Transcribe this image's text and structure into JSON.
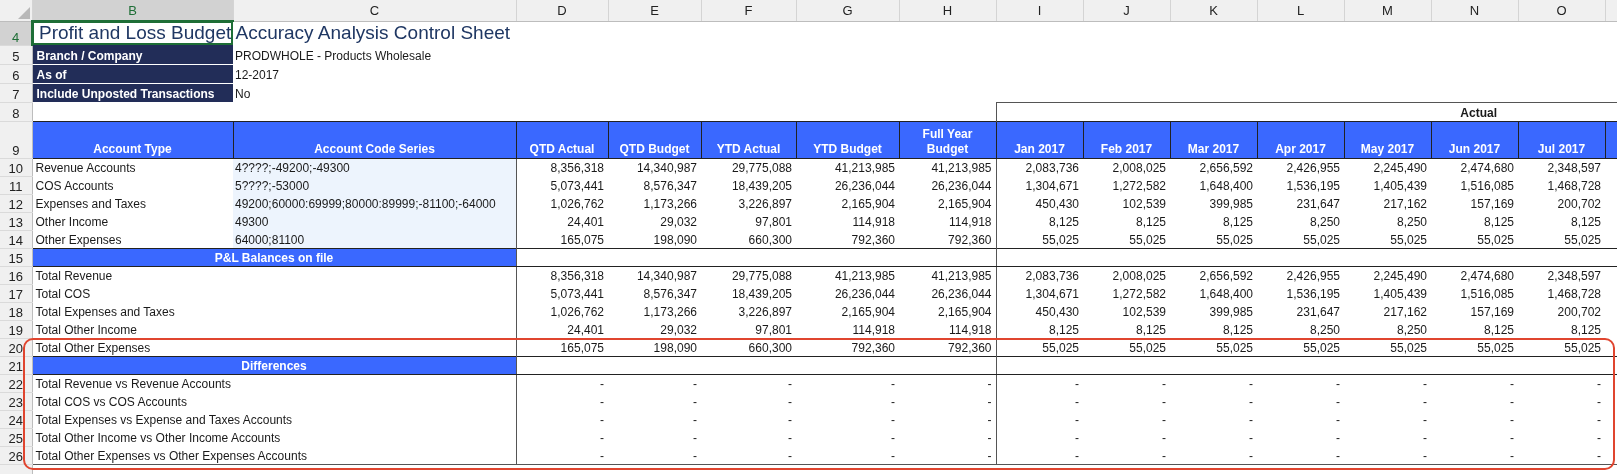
{
  "columns": [
    {
      "letter": "B",
      "selected": true
    },
    {
      "letter": "C",
      "selected": false
    },
    {
      "letter": "D",
      "selected": false
    },
    {
      "letter": "E",
      "selected": false
    },
    {
      "letter": "F",
      "selected": false
    },
    {
      "letter": "G",
      "selected": false
    },
    {
      "letter": "H",
      "selected": false
    },
    {
      "letter": "I",
      "selected": false
    },
    {
      "letter": "J",
      "selected": false
    },
    {
      "letter": "K",
      "selected": false
    },
    {
      "letter": "L",
      "selected": false
    },
    {
      "letter": "M",
      "selected": false
    },
    {
      "letter": "N",
      "selected": false
    },
    {
      "letter": "O",
      "selected": false
    }
  ],
  "rows": [
    {
      "kind": "title",
      "number": "4",
      "selected": true,
      "text": "Profit and Loss Budget Accuracy Analysis Control Sheet"
    },
    {
      "kind": "info",
      "number": "5",
      "selected": false,
      "label": "Branch / Company",
      "value": "PRODWHOLE - Products Wholesale"
    },
    {
      "kind": "info",
      "number": "6",
      "selected": false,
      "label": "As of",
      "value": "12-2017"
    },
    {
      "kind": "info",
      "number": "7",
      "selected": false,
      "label": "Include Unposted Transactions",
      "value": "No"
    },
    {
      "kind": "group",
      "number": "8",
      "selected": false,
      "group_label": "Actual"
    },
    {
      "kind": "header",
      "number": "9",
      "selected": false,
      "cells": [
        "Account Type",
        "Account Code Series",
        "QTD Actual",
        "QTD Budget",
        "YTD Actual",
        "YTD Budget",
        "Full Year Budget",
        "Jan 2017",
        "Feb 2017",
        "Mar 2017",
        "Apr 2017",
        "May 2017",
        "Jun 2017",
        "Jul 2017"
      ]
    },
    {
      "kind": "account",
      "number": "10",
      "selected": false,
      "label": "Revenue Accounts",
      "code": "4????;-49200;-49300",
      "values": [
        "8,356,318",
        "14,340,987",
        "29,775,088",
        "41,213,985",
        "41,213,985",
        "2,083,736",
        "2,008,025",
        "2,656,592",
        "2,426,955",
        "2,245,490",
        "2,474,680",
        "2,348,597"
      ]
    },
    {
      "kind": "account",
      "number": "11",
      "selected": false,
      "label": "COS Accounts",
      "code": "5????;-53000",
      "values": [
        "5,073,441",
        "8,576,347",
        "18,439,205",
        "26,236,044",
        "26,236,044",
        "1,304,671",
        "1,272,582",
        "1,648,400",
        "1,536,195",
        "1,405,439",
        "1,516,085",
        "1,468,728"
      ]
    },
    {
      "kind": "account",
      "number": "12",
      "selected": false,
      "label": "Expenses and Taxes",
      "code": "49200;60000:69999;80000:89999;-81100;-64000",
      "values": [
        "1,026,762",
        "1,173,266",
        "3,226,897",
        "2,165,904",
        "2,165,904",
        "450,430",
        "102,539",
        "399,985",
        "231,647",
        "217,162",
        "157,169",
        "200,702"
      ]
    },
    {
      "kind": "account",
      "number": "13",
      "selected": false,
      "label": "Other Income",
      "code": "49300",
      "values": [
        "24,401",
        "29,032",
        "97,801",
        "114,918",
        "114,918",
        "8,125",
        "8,125",
        "8,125",
        "8,250",
        "8,250",
        "8,125",
        "8,125"
      ]
    },
    {
      "kind": "account",
      "number": "14",
      "selected": false,
      "label": "Other Expenses",
      "code": "64000;81100",
      "values": [
        "165,075",
        "198,090",
        "660,300",
        "792,360",
        "792,360",
        "55,025",
        "55,025",
        "55,025",
        "55,025",
        "55,025",
        "55,025",
        "55,025"
      ]
    },
    {
      "kind": "banner",
      "number": "15",
      "selected": false,
      "heading": "P&L Balances on file"
    },
    {
      "kind": "total",
      "number": "16",
      "selected": false,
      "label": "Total Revenue",
      "values": [
        "8,356,318",
        "14,340,987",
        "29,775,088",
        "41,213,985",
        "41,213,985",
        "2,083,736",
        "2,008,025",
        "2,656,592",
        "2,426,955",
        "2,245,490",
        "2,474,680",
        "2,348,597"
      ]
    },
    {
      "kind": "total",
      "number": "17",
      "selected": false,
      "label": "Total COS",
      "values": [
        "5,073,441",
        "8,576,347",
        "18,439,205",
        "26,236,044",
        "26,236,044",
        "1,304,671",
        "1,272,582",
        "1,648,400",
        "1,536,195",
        "1,405,439",
        "1,516,085",
        "1,468,728"
      ]
    },
    {
      "kind": "total",
      "number": "18",
      "selected": false,
      "label": "Total Expenses and Taxes",
      "values": [
        "1,026,762",
        "1,173,266",
        "3,226,897",
        "2,165,904",
        "2,165,904",
        "450,430",
        "102,539",
        "399,985",
        "231,647",
        "217,162",
        "157,169",
        "200,702"
      ]
    },
    {
      "kind": "total",
      "number": "19",
      "selected": false,
      "label": "Total Other Income",
      "values": [
        "24,401",
        "29,032",
        "97,801",
        "114,918",
        "114,918",
        "8,125",
        "8,125",
        "8,125",
        "8,250",
        "8,250",
        "8,125",
        "8,125"
      ]
    },
    {
      "kind": "total",
      "number": "20",
      "selected": false,
      "label": "Total Other Expenses",
      "values": [
        "165,075",
        "198,090",
        "660,300",
        "792,360",
        "792,360",
        "55,025",
        "55,025",
        "55,025",
        "55,025",
        "55,025",
        "55,025",
        "55,025"
      ]
    },
    {
      "kind": "banner",
      "number": "21",
      "selected": false,
      "heading": "Differences"
    },
    {
      "kind": "difference",
      "number": "22",
      "selected": false,
      "label": "Total Revenue vs Revenue Accounts",
      "values": [
        "-",
        "-",
        "-",
        "-",
        "-",
        "-",
        "-",
        "-",
        "-",
        "-",
        "-",
        "-"
      ]
    },
    {
      "kind": "difference",
      "number": "23",
      "selected": false,
      "label": "Total COS vs COS Accounts",
      "values": [
        "-",
        "-",
        "-",
        "-",
        "-",
        "-",
        "-",
        "-",
        "-",
        "-",
        "-",
        "-"
      ]
    },
    {
      "kind": "difference",
      "number": "24",
      "selected": false,
      "label": "Total Expenses vs Expense and Taxes Accounts",
      "values": [
        "-",
        "-",
        "-",
        "-",
        "-",
        "-",
        "-",
        "-",
        "-",
        "-",
        "-",
        "-"
      ]
    },
    {
      "kind": "difference",
      "number": "25",
      "selected": false,
      "label": "Total Other Income vs Other Income Accounts",
      "values": [
        "-",
        "-",
        "-",
        "-",
        "-",
        "-",
        "-",
        "-",
        "-",
        "-",
        "-",
        "-"
      ]
    },
    {
      "kind": "difference",
      "number": "26",
      "selected": false,
      "label": "Total Other Expenses vs Other Expenses Accounts",
      "values": [
        "-",
        "-",
        "-",
        "-",
        "-",
        "-",
        "-",
        "-",
        "-",
        "-",
        "-",
        "-"
      ]
    }
  ],
  "annotation_frame": true
}
